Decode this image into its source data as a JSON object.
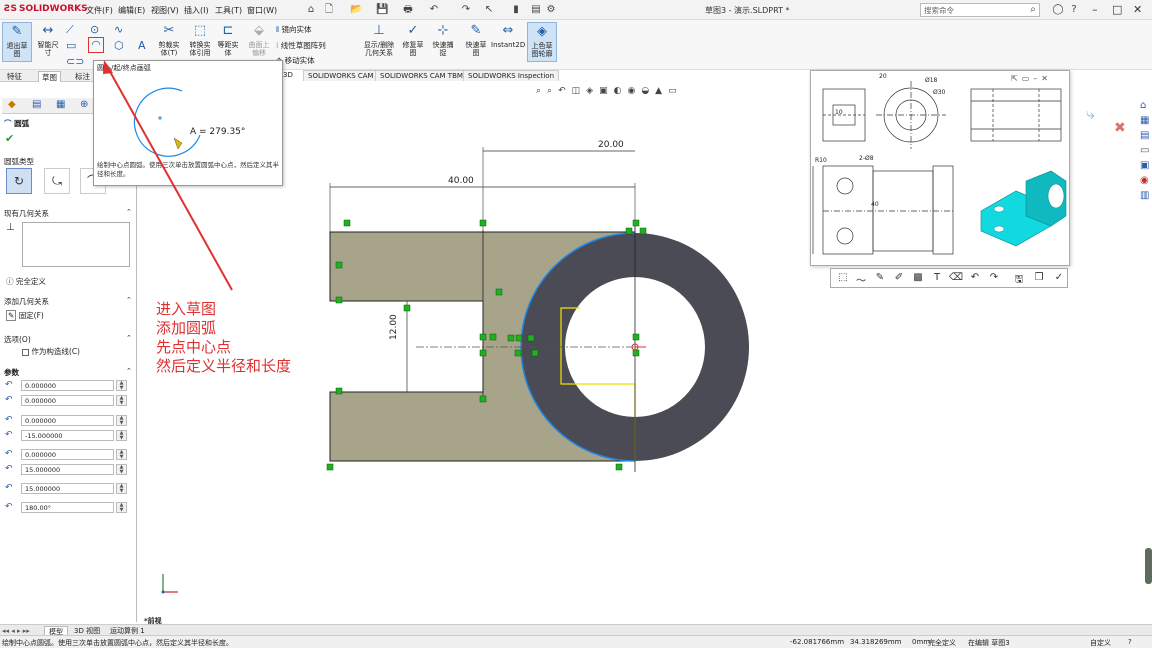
{
  "app": {
    "brand": "SOLIDWORKS",
    "document_title": "草图3 - 演示.SLDPRT *"
  },
  "menus": [
    "文件(F)",
    "编辑(E)",
    "视图(V)",
    "插入(I)",
    "工具(T)",
    "窗口(W)"
  ],
  "search": {
    "placeholder": "搜索命令"
  },
  "ribbon": {
    "exit_sketch": "退出草\n图",
    "smart_dim": "智能尺\n寸",
    "trim": "剪裁实\n体(T)",
    "convert": "转换实\n体引用",
    "offset": "等距实\n体",
    "surface_offset": "曲面上\n偏移",
    "mirror": "镜向实体",
    "linear_pattern": "线性草图阵列",
    "move": "移动实体",
    "relations": "显示/删除\n几何关系",
    "repair": "修复草\n图",
    "quick_snap": "快速捕\n捉",
    "rapid_sketch": "快速草\n图",
    "instant2d": "Instant2D",
    "shaded_contours": "上色草\n图轮廓"
  },
  "left_tabs": [
    "特征",
    "草图",
    "标注"
  ],
  "cam_tabs": [
    "SOLIDWORKS CAM",
    "SOLIDWORKS CAM TBM",
    "SOLIDWORKS Inspection"
  ],
  "tooltip": {
    "title": "圆心/起/终点画弧",
    "angle": "A = 279.35°",
    "desc": "绘制中心点圆弧。使用三次单击放置圆弧中心点，然后定义其半径和长度。"
  },
  "property_manager": {
    "title": "圆弧",
    "arc_type_label": "圆弧类型",
    "existing_relations": "现有几何关系",
    "fully_defined": "完全定义",
    "add_relations": "添加几何关系",
    "fix_label": "固定(F)",
    "options": "选项(O)",
    "construction": "作为构造线(C)",
    "params": "参数",
    "cx": "0.000000",
    "cy": "0.000000",
    "sx": "0.000000",
    "sy": "-15.000000",
    "ex": "0.000000",
    "ey": "15.000000",
    "radius": "15.000000",
    "angle": "180.00°"
  },
  "dims": {
    "d20": "20.00",
    "d40": "40.00",
    "d12": "12.00"
  },
  "drawing_labels": {
    "d20": "20",
    "phi18": "Ø18",
    "phi30": "Ø30",
    "r10": "R10",
    "phi8": "2-Ø8",
    "d40": "40",
    "d10": "10"
  },
  "annotation": [
    "进入草图",
    "添加圆弧",
    "先点中心点",
    "然后定义半径和长度"
  ],
  "view_label": "*前视",
  "bottom_tabs": [
    "模型",
    "3D 视图",
    "运动算例 1"
  ],
  "status": {
    "message": "绘制中心点圆弧。使用三次单击放置圆弧中心点，然后定义其半径和长度。",
    "x": "-62.081766mm",
    "y": "34.318269mm",
    "z": "0mm",
    "defined": "完全定义",
    "editing": "在编辑 草图3",
    "custom": "自定义"
  },
  "colors": {
    "accent": "#1f5fa8",
    "annotation": "#e03030",
    "sketch_fill": "#a7a48a",
    "ring": "#4a4b55",
    "cyan": "#12d9e0"
  }
}
